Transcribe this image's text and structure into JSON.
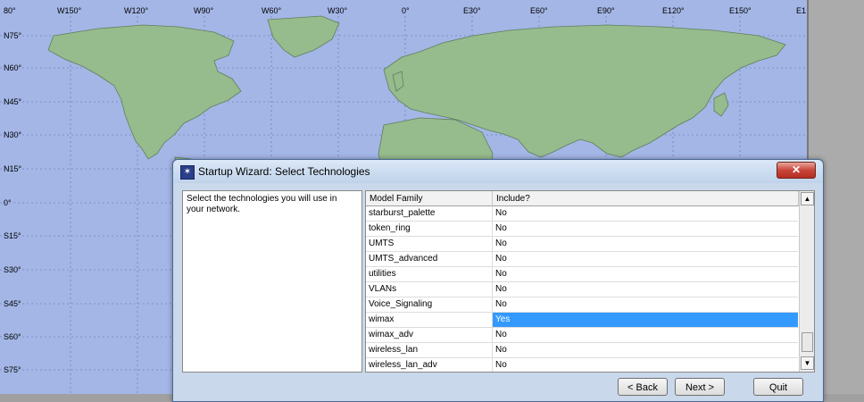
{
  "map": {
    "top_labels": [
      "80°",
      "W150°",
      "W120°",
      "W90°",
      "W60°",
      "W30°",
      "0°",
      "E30°",
      "E60°",
      "E90°",
      "E120°",
      "E150°",
      "E1"
    ],
    "left_labels": [
      "N75°",
      "N60°",
      "N45°",
      "N30°",
      "N15°",
      "0°",
      "S15°",
      "S30°",
      "S45°",
      "S60°",
      "S75°"
    ],
    "colors": {
      "ocean": "#a4b6e6",
      "land": "#96bb8d",
      "border": "#5f7f5a"
    }
  },
  "dialog": {
    "title": "Startup Wizard: Select Technologies",
    "close_symbol": "✕",
    "description": "Select the technologies you will use in your network.",
    "table": {
      "headers": [
        "Model Family",
        "Include?"
      ],
      "rows": [
        {
          "family": "starburst_palette",
          "include": "No"
        },
        {
          "family": "token_ring",
          "include": "No"
        },
        {
          "family": "UMTS",
          "include": "No"
        },
        {
          "family": "UMTS_advanced",
          "include": "No"
        },
        {
          "family": "utilities",
          "include": "No"
        },
        {
          "family": "VLANs",
          "include": "No"
        },
        {
          "family": "Voice_Signaling",
          "include": "No"
        },
        {
          "family": "wimax",
          "include": "Yes",
          "selected": true
        },
        {
          "family": "wimax_adv",
          "include": "No"
        },
        {
          "family": "wireless_lan",
          "include": "No"
        },
        {
          "family": "wireless_lan_adv",
          "include": "No"
        }
      ]
    },
    "buttons": {
      "back": "< Back",
      "next": "Next >",
      "quit": "Quit"
    }
  }
}
